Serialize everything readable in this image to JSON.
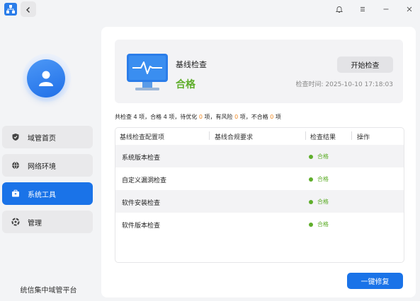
{
  "icons": {
    "app": "app-logo-icon",
    "back": "chevron-left-icon",
    "theme": "bell-icon",
    "menu": "menu-icon",
    "minimize": "minimize-icon",
    "close": "close-icon"
  },
  "colors": {
    "accent": "#1a73e8",
    "pass": "#5fae2b",
    "warn": "#f08a24"
  },
  "sidebar": {
    "items": [
      {
        "label": "域管首页",
        "icon": "shield-icon",
        "active": false
      },
      {
        "label": "网络环境",
        "icon": "globe-icon",
        "active": false
      },
      {
        "label": "系统工具",
        "icon": "toolbox-icon",
        "active": true
      },
      {
        "label": "管理",
        "icon": "manage-icon",
        "active": false
      }
    ],
    "footer": "统信集中域管平台"
  },
  "main": {
    "header": {
      "title": "基线检查",
      "status": "合格",
      "start_button": "开始检查",
      "check_time": "检查时间: 2025-10-10 17:18:03"
    },
    "summary": {
      "p1": "共检查 4 项，合格 4 项，待优化 ",
      "optimize": "0",
      "p2": " 项，有风险 ",
      "risk": "0",
      "p3": " 项，不合格 ",
      "fail": "0",
      "p4": " 项"
    },
    "table": {
      "headers": [
        "基线检查配置项",
        "基线合规要求",
        "检查结果",
        "操作"
      ],
      "rows": [
        {
          "name": "系统版本检查",
          "result": "合格"
        },
        {
          "name": "自定义漏洞检查",
          "result": "合格"
        },
        {
          "name": "软件安装检查",
          "result": "合格"
        },
        {
          "name": "软件版本检查",
          "result": "合格"
        }
      ]
    },
    "fix_button": "一键修复"
  }
}
